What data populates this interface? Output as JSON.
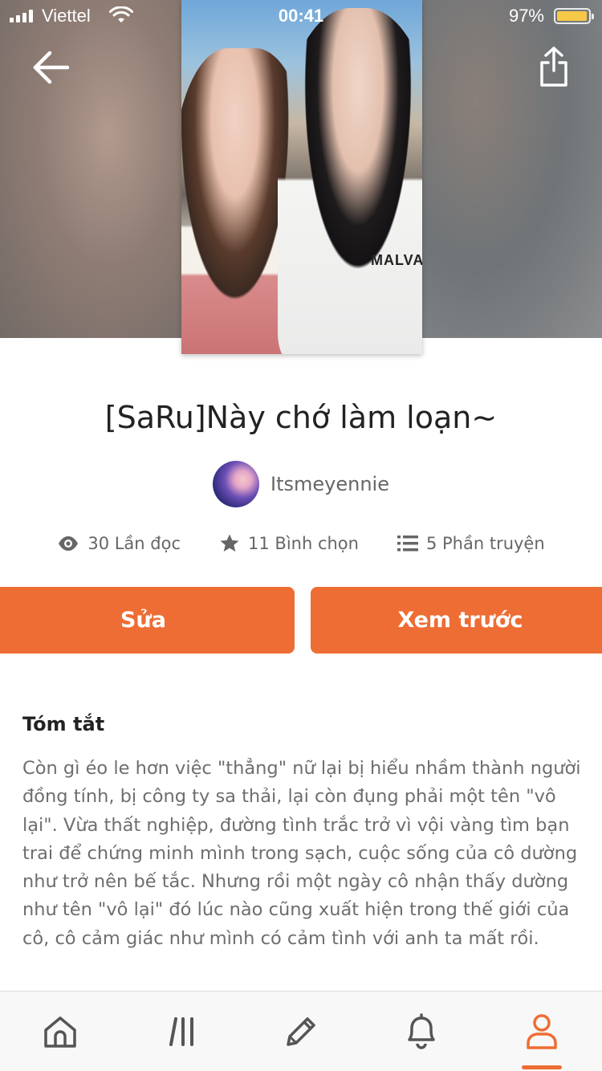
{
  "status_bar": {
    "carrier": "Viettel",
    "time": "00:41",
    "battery_percent_text": "97%",
    "battery_level": 0.97
  },
  "header": {
    "back_icon": "arrow-left-icon",
    "share_icon": "share-icon"
  },
  "story": {
    "title": "[SaRu]Này chớ làm loạn~",
    "author": "Itsmeyennie",
    "cover_shirt_text": "MALVAC"
  },
  "stats": {
    "reads": "30 Lần đọc",
    "votes": "11 Bình chọn",
    "parts": "5 Phần truyện"
  },
  "actions": {
    "edit_label": "Sửa",
    "preview_label": "Xem trước"
  },
  "summary": {
    "heading": "Tóm tắt",
    "body": "Còn gì éo le hơn việc \"thẳng\" nữ lại bị hiểu nhầm thành người đồng tính, bị công ty sa thải, lại còn đụng phải một tên \"vô lại\". Vừa thất nghiệp, đường tình trắc trở vì vội vàng tìm bạn trai để chứng minh mình trong sạch, cuộc sống của cô dường như trở nên bế tắc. Nhưng rồi một ngày cô nhận thấy dường như tên \"vô lại\" đó lúc nào cũng xuất hiện trong thế giới của cô, cô cảm giác như mình có cảm tình với anh ta mất rồi."
  },
  "tabbar": {
    "items": [
      "home-icon",
      "library-icon",
      "write-icon",
      "notifications-icon",
      "profile-icon"
    ],
    "active": "profile-icon",
    "accent_color": "#ee6d34"
  }
}
